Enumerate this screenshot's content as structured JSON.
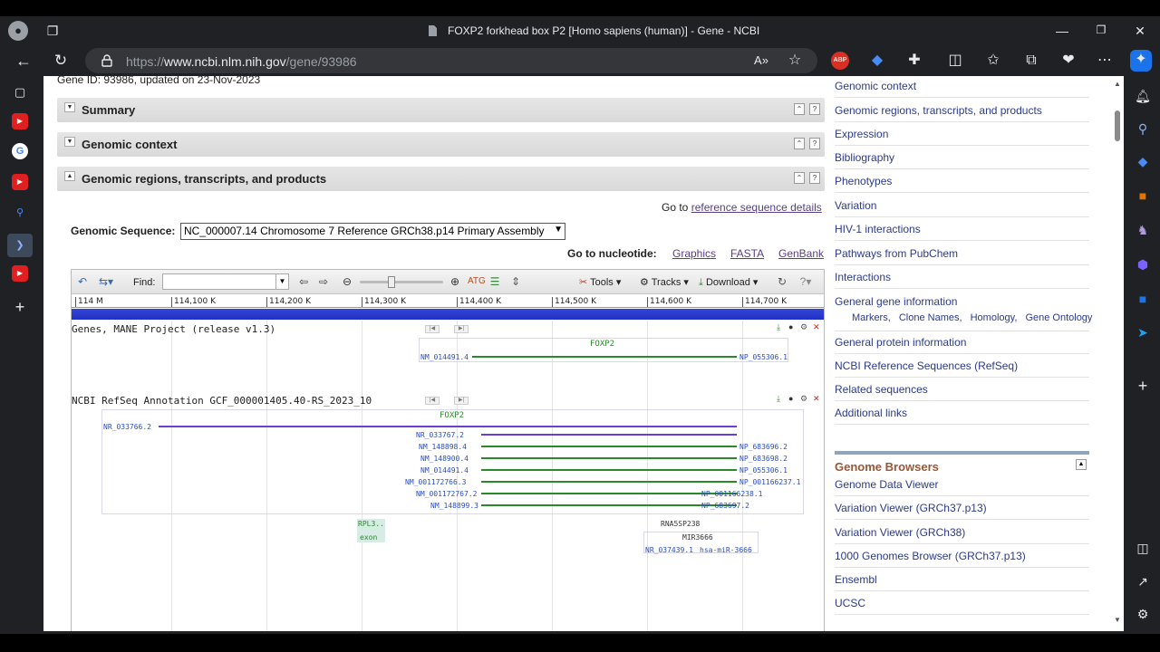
{
  "browser": {
    "tab_title": "FOXP2 forkhead box P2 [Homo sapiens (human)] - Gene - NCBI",
    "url_prefix": "https://",
    "url_host": "www.ncbi.nlm.nih.gov",
    "url_path": "/gene/93986",
    "abp_label": "ABP"
  },
  "page": {
    "gene_id_line": "Gene ID: 93986, updated on 23-Nov-2023",
    "sections": [
      {
        "label": "Summary"
      },
      {
        "label": "Genomic context"
      },
      {
        "label": "Genomic regions, transcripts, and products"
      }
    ],
    "goto_prefix": "Go to",
    "goto_link": "reference sequence details",
    "genomic_sequence_label": "Genomic Sequence:",
    "genomic_sequence_value": "NC_000007.14 Chromosome 7 Reference GRCh38.p14 Primary Assembly",
    "goto_nucleotide_label": "Go to nucleotide:",
    "nucleotide_links": [
      "Graphics",
      "FASTA",
      "GenBank"
    ]
  },
  "viewer": {
    "find_label": "Find:",
    "tools_label": "Tools",
    "tracks_label": "Tracks",
    "download_label": "Download",
    "ruler_ticks": [
      "114 M",
      "114,100 K",
      "114,200 K",
      "114,300 K",
      "114,400 K",
      "114,500 K",
      "114,600 K",
      "114,700 K"
    ],
    "track1_label": "Genes, MANE Project (release v1.3)",
    "track1_gene": "FOXP2",
    "track1_left": "NM_014491.4",
    "track1_right": "NP_055306.1",
    "track2_label": "NCBI RefSeq Annotation GCF_000001405.40-RS_2023_10",
    "track2_gene": "FOXP2",
    "nr_transcript": "NR_033766.2",
    "transcripts": [
      {
        "left": "NR_033767.2",
        "right": ""
      },
      {
        "left": "NM_148898.4",
        "right": "NP_683696.2"
      },
      {
        "left": "NM_148900.4",
        "right": "NP_683698.2"
      },
      {
        "left": "NM_014491.4",
        "right": "NP_055306.1"
      },
      {
        "left": "NM_001172766.3",
        "right": "NP_001166237.1"
      },
      {
        "left": "NM_001172767.2",
        "right": "NP_001166238.1"
      },
      {
        "left": "NM_148899.3",
        "right": "NP_683697.2"
      }
    ],
    "rpl_label": "RPL3..",
    "exon_label": "exon",
    "rna5sp_label": "RNA5SP238",
    "mir_label": "MIR3666",
    "mir_left": "NR_037439.1",
    "mir_right": "hsa-miR-3666"
  },
  "right_nav": {
    "items": [
      "Genomic context",
      "Genomic regions, transcripts, and products",
      "Expression",
      "Bibliography",
      "Phenotypes",
      "Variation",
      "HIV-1 interactions",
      "Pathways from PubChem",
      "Interactions",
      "General gene information",
      "General protein information",
      "NCBI Reference Sequences (RefSeq)",
      "Related sequences",
      "Additional links"
    ],
    "sub_items": [
      "Markers,",
      "Clone Names,",
      "Homology,",
      "Gene Ontology"
    ],
    "genome_browsers_title": "Genome Browsers",
    "browsers": [
      "Genome Data Viewer",
      "Variation Viewer (GRCh37.p13)",
      "Variation Viewer (GRCh38)",
      "1000 Genomes Browser (GRCh37.p13)",
      "Ensembl",
      "UCSC"
    ]
  },
  "colors": {
    "accent_blue": "#2030c4",
    "transcript_purple": "#6a3fd0",
    "transcript_green": "#2a8a2a",
    "link": "#2b3a8c"
  }
}
